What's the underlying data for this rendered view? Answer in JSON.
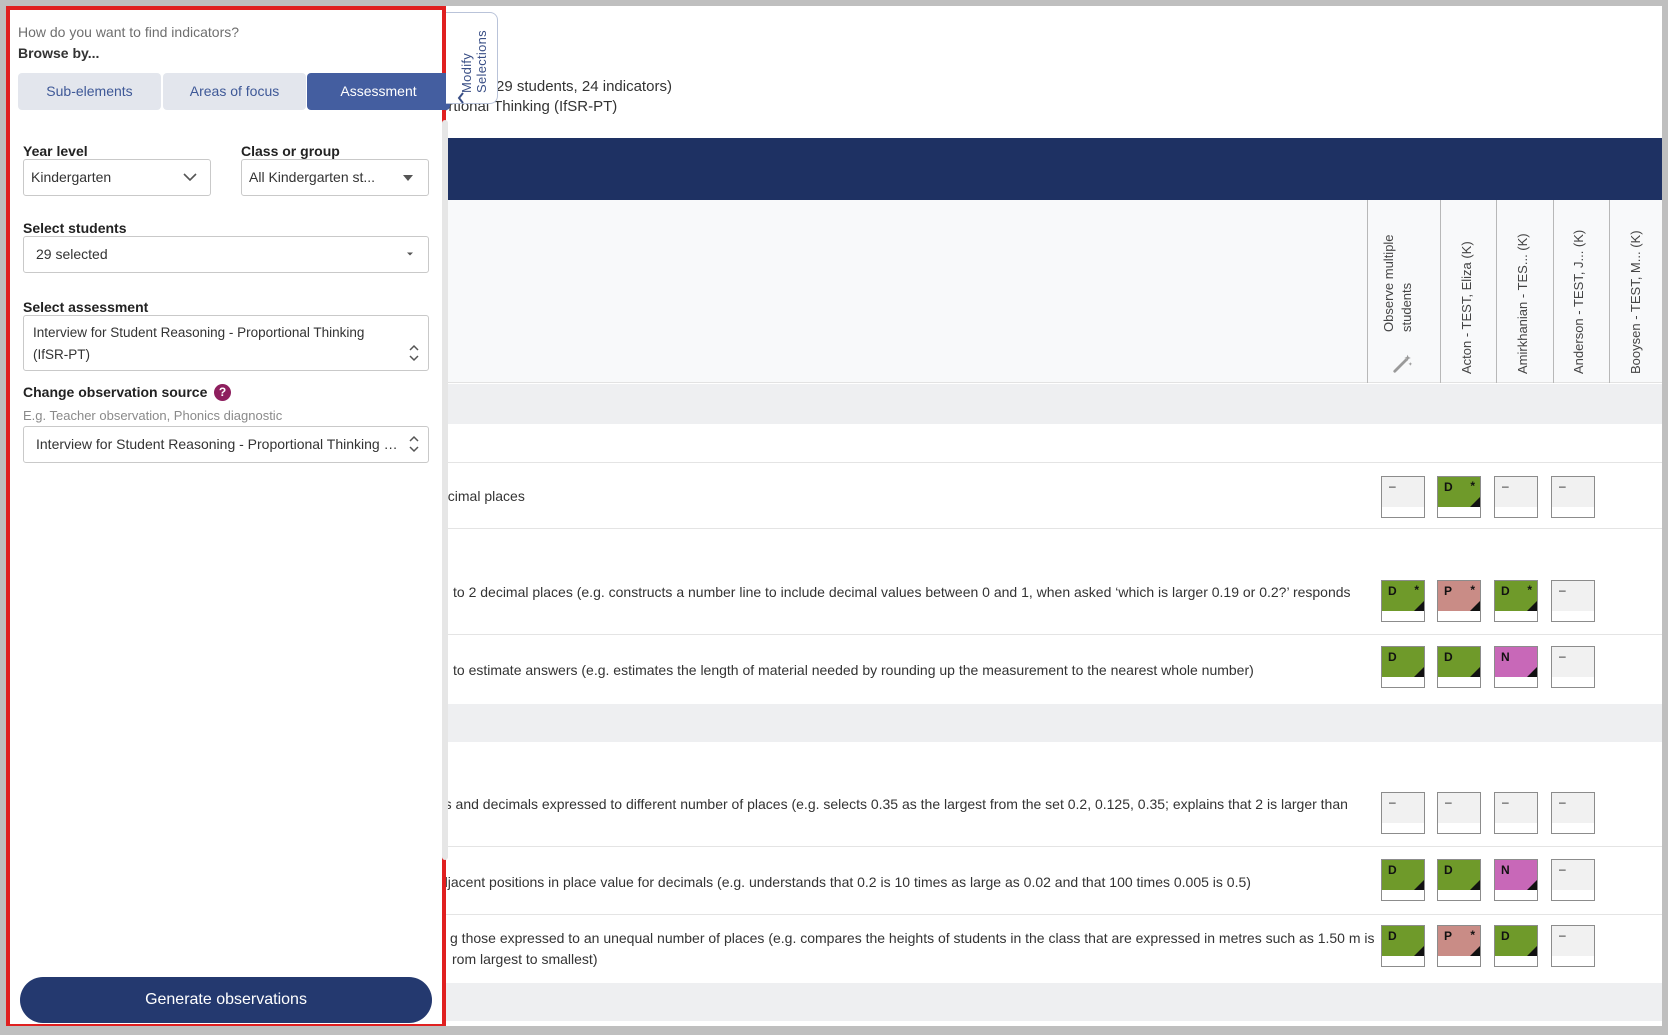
{
  "main": {
    "summary_line1": "29 students, 24 indicators)",
    "summary_line2": "ortional Thinking (IfSR-PT)",
    "observe_label": "Observe multiple students",
    "students": [
      "Acton - TEST, Eliza (K)",
      "Amirkhanian - TES... (K)",
      "Anderson - TEST, J... (K)",
      "Booysen - TEST, M... (K)"
    ],
    "rows": [
      {
        "text": "ecimal places",
        "cells": [
          {
            "code": "–",
            "color": "dash",
            "star": false
          },
          {
            "code": "D",
            "color": "green",
            "star": true
          },
          {
            "code": "–",
            "color": "dash",
            "star": false
          },
          {
            "code": "–",
            "color": "dash",
            "star": false
          }
        ]
      },
      {
        "text": "to 2 decimal places (e.g. constructs a number line to include decimal values between 0 and 1, when asked ‘which is larger 0.19 or 0.2?’ responds",
        "cells": [
          {
            "code": "D",
            "color": "green",
            "star": true
          },
          {
            "code": "P",
            "color": "pink",
            "star": true
          },
          {
            "code": "D",
            "color": "green",
            "star": true
          },
          {
            "code": "–",
            "color": "dash",
            "star": false
          }
        ]
      },
      {
        "text": "to estimate answers (e.g. estimates the length of material needed by rounding up the measurement to the nearest whole number)",
        "cells": [
          {
            "code": "D",
            "color": "green",
            "star": false
          },
          {
            "code": "D",
            "color": "green",
            "star": false
          },
          {
            "code": "N",
            "color": "magenta",
            "star": false
          },
          {
            "code": "–",
            "color": "dash",
            "star": false
          }
        ]
      },
      {
        "text": "rs and decimals expressed to different number of places (e.g. selects 0.35 as the largest from the set 0.2, 0.125, 0.35; explains that 2 is larger than",
        "cells": [
          {
            "code": "–",
            "color": "dash",
            "star": false
          },
          {
            "code": "–",
            "color": "dash",
            "star": false
          },
          {
            "code": "–",
            "color": "dash",
            "star": false
          },
          {
            "code": "–",
            "color": "dash",
            "star": false
          }
        ]
      },
      {
        "text": "djacent positions in place value for decimals (e.g. understands that 0.2 is 10 times as large as 0.02 and that 100 times 0.005 is 0.5)",
        "cells": [
          {
            "code": "D",
            "color": "green",
            "star": false
          },
          {
            "code": "D",
            "color": "green",
            "star": false
          },
          {
            "code": "N",
            "color": "magenta",
            "star": false
          },
          {
            "code": "–",
            "color": "dash",
            "star": false
          }
        ]
      },
      {
        "text": "g those expressed to an unequal number of places (e.g. compares the heights of students in the class that are expressed in metres such as 1.50 m is",
        "text2": "rom largest to smallest)",
        "cells": [
          {
            "code": "D",
            "color": "green",
            "star": false
          },
          {
            "code": "P",
            "color": "pink",
            "star": true
          },
          {
            "code": "D",
            "color": "green",
            "star": false
          },
          {
            "code": "–",
            "color": "dash",
            "star": false
          }
        ]
      }
    ]
  },
  "modify_tab": {
    "label": "Modify Selections",
    "icon": "chevron-left-icon"
  },
  "panel": {
    "prompt": "How do you want to find indicators?",
    "browse_by": "Browse by...",
    "tabs": [
      {
        "label": "Sub-elements",
        "active": false
      },
      {
        "label": "Areas of focus",
        "active": false
      },
      {
        "label": "Assessment",
        "active": true
      }
    ],
    "year_level": {
      "label": "Year level",
      "value": "Kindergarten"
    },
    "class_group": {
      "label": "Class or group",
      "value": "All Kindergarten st..."
    },
    "select_students": {
      "label": "Select students",
      "value": "29 selected"
    },
    "select_assessment": {
      "label": "Select assessment",
      "value_line1": "Interview for Student Reasoning - Proportional Thinking",
      "value_line2": "(IfSR-PT)"
    },
    "observation_source": {
      "label": "Change observation source",
      "help": "?",
      "hint": "E.g. Teacher observation, Phonics diagnostic",
      "value": "Interview for Student Reasoning - Proportional Thinking (If..."
    },
    "generate_button": "Generate observations"
  },
  "colors": {
    "navy": "#1e3163",
    "button_navy": "#24396f",
    "tab_active": "#445ea0",
    "highlight_border": "#e02020",
    "code_D": "#6f9a2a",
    "code_P": "#c98c86",
    "code_N": "#c868b8"
  }
}
